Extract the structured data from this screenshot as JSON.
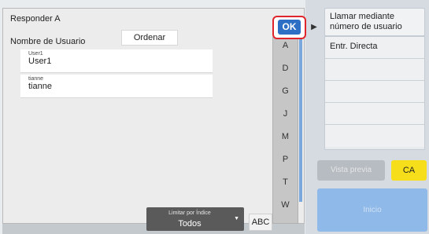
{
  "background": {
    "call_by_number_label": "Llamar mediante número de usuario",
    "direct_entry_label": "Entr. Directa",
    "gray_button_label": "Vista previa",
    "ca_label": "CA",
    "start_label": "Inicio"
  },
  "dialog": {
    "title": "Responder A",
    "column_header": "Nombre de Usuario",
    "sort_label": "Ordenar",
    "ok_label": "OK",
    "entries": [
      {
        "small": "User1",
        "big": "User1"
      },
      {
        "small": "tianne",
        "big": "tianne"
      }
    ],
    "index_letters": [
      "A",
      "D",
      "G",
      "J",
      "M",
      "P",
      "T",
      "W"
    ],
    "limit_label": "Limitar por Índice",
    "limit_value": "Todos",
    "abc_label": "ABC"
  },
  "colors": {
    "ok_blue": "#2d6fc4",
    "highlight_red": "#e0242b",
    "ca_yellow": "#f6de1a"
  }
}
